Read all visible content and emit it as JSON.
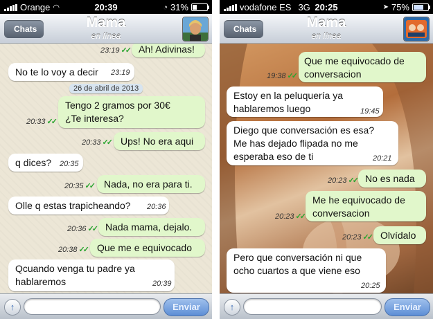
{
  "left": {
    "status": {
      "carrier": "Orange",
      "time": "20:39",
      "battery": "31%",
      "battery_level": 0.31
    },
    "nav": {
      "back": "Chats",
      "title": "Mama",
      "subtitle": "en línea"
    },
    "date_pill": "26 de abril de 2013",
    "messages": [
      {
        "dir": "out",
        "text": "Ah! Adivinas!",
        "time": "23:19"
      },
      {
        "dir": "in",
        "text": "No te lo voy a decir",
        "time": "23:19"
      },
      {
        "dir": "out",
        "text": "Tengo 2 gramos por 30€ ¿Te interesa?",
        "time": "20:33"
      },
      {
        "dir": "out",
        "text": "Ups! No era aqui",
        "time": "20:33"
      },
      {
        "dir": "in",
        "text": "q dices?",
        "time": "20:35"
      },
      {
        "dir": "out",
        "text": "Nada, no era para ti.",
        "time": "20:35"
      },
      {
        "dir": "in",
        "text": "Olle q estas trapicheando?",
        "time": "20:36"
      },
      {
        "dir": "out",
        "text": "Nada mama, dejalo.",
        "time": "20:36"
      },
      {
        "dir": "out",
        "text": "Que me e equivocado",
        "time": "20:38"
      },
      {
        "dir": "in",
        "text": "Qcuando venga tu padre ya hablaremos",
        "time": "20:39"
      }
    ],
    "send": "Enviar"
  },
  "right": {
    "status": {
      "carrier": "vodafone ES",
      "network": "3G",
      "time": "20:25",
      "battery": "75%",
      "battery_level": 0.75
    },
    "nav": {
      "back": "Chats",
      "title": "Mama",
      "subtitle": "en línea"
    },
    "messages": [
      {
        "dir": "out",
        "text": "Que me equivocado de conversacion",
        "time": "19:38"
      },
      {
        "dir": "in",
        "text": "Estoy en la peluquería ya hablaremos luego",
        "time": "19:45"
      },
      {
        "dir": "in",
        "text": "Diego que  conversación es esa? Me has dejado flipada no me esperaba eso de ti",
        "time": "20:21"
      },
      {
        "dir": "out",
        "text": "No es nada",
        "time": "20:23"
      },
      {
        "dir": "out",
        "text": "Me he equivocado de conversacion",
        "time": "20:23"
      },
      {
        "dir": "out",
        "text": "Olvídalo",
        "time": "20:23"
      },
      {
        "dir": "in",
        "text": "Pero que conversación ni que ocho cuartos a que viene eso",
        "time": "20:25"
      }
    ],
    "send": "Enviar"
  }
}
